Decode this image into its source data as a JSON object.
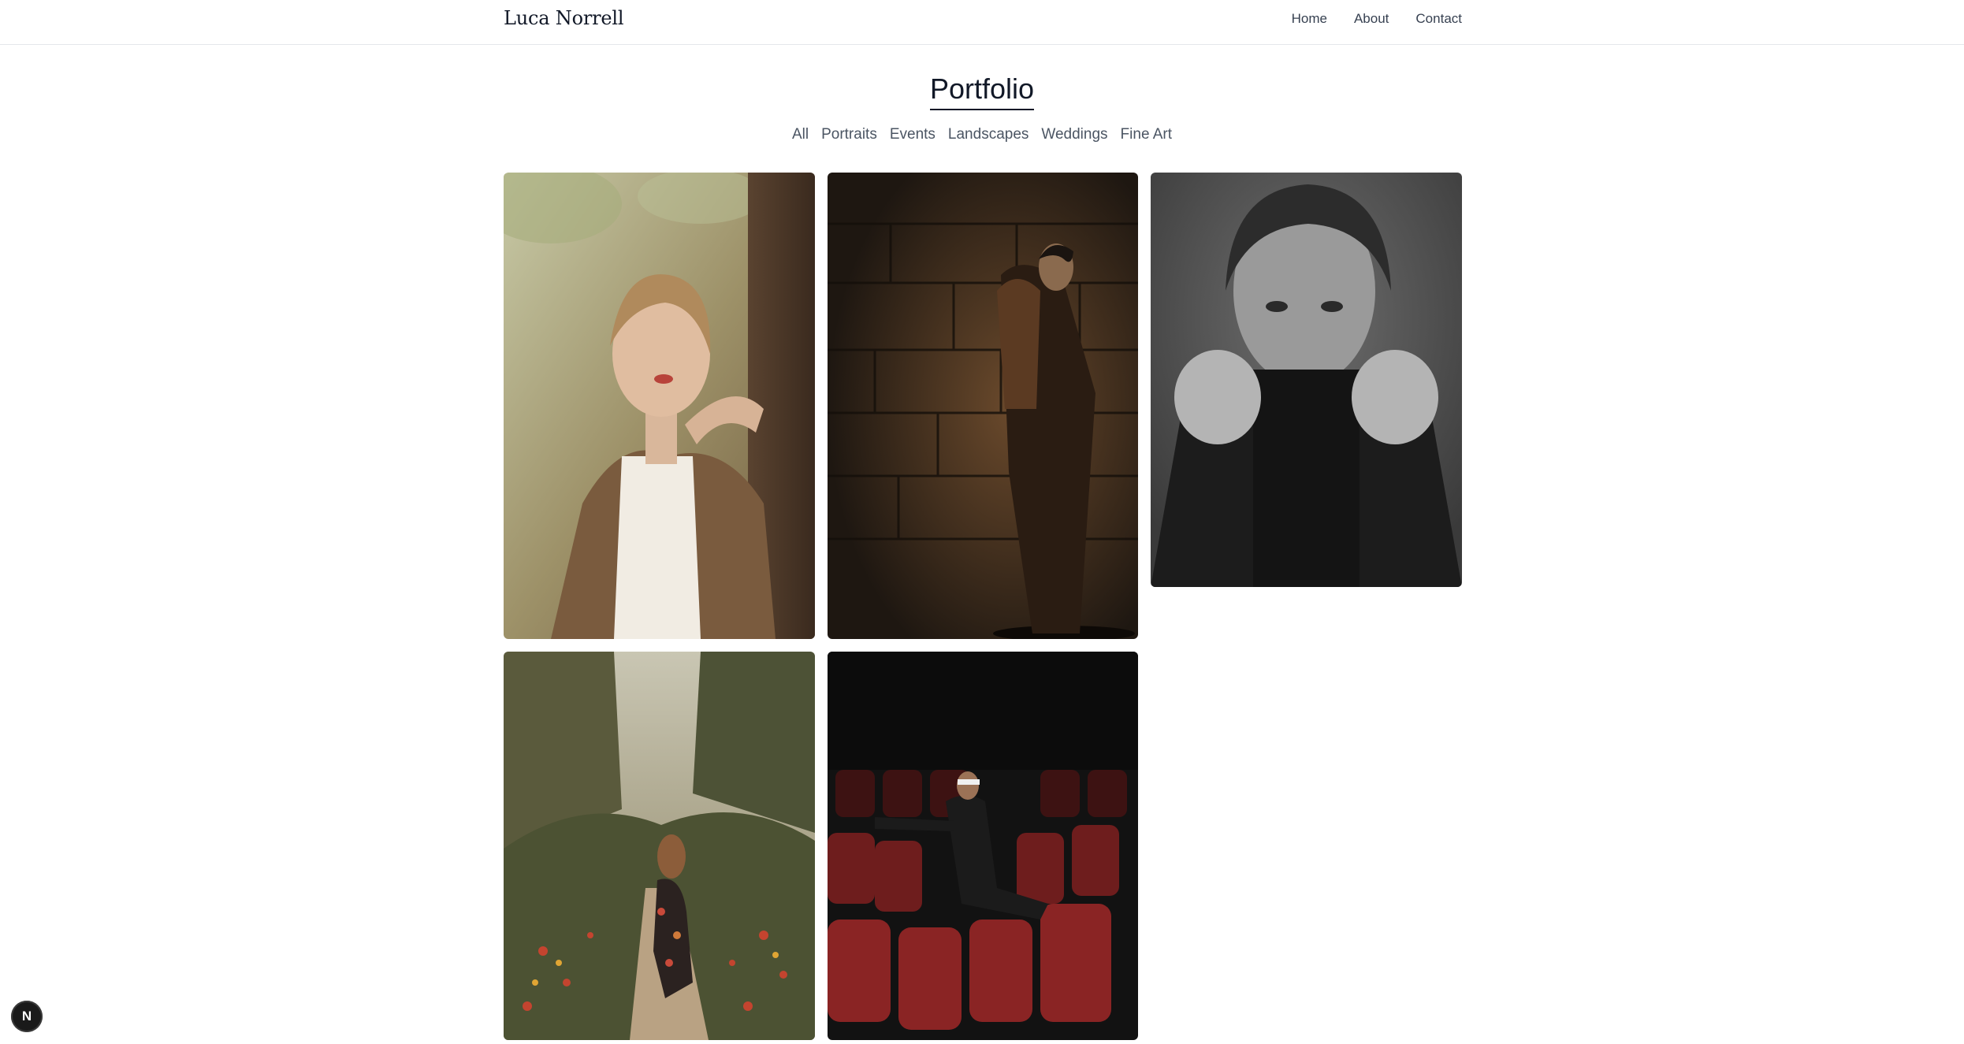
{
  "header": {
    "brand": "Luca Norrell",
    "nav": [
      {
        "label": "Home"
      },
      {
        "label": "About"
      },
      {
        "label": "Contact"
      }
    ]
  },
  "page": {
    "title": "Portfolio"
  },
  "filters": [
    {
      "label": "All"
    },
    {
      "label": "Portraits"
    },
    {
      "label": "Events"
    },
    {
      "label": "Landscapes"
    },
    {
      "label": "Weddings"
    },
    {
      "label": "Fine Art"
    }
  ],
  "photos": [
    {
      "subject": "woman leaning on tree in olive grove"
    },
    {
      "subject": "man in long coat against stone wall"
    },
    {
      "subject": "black and white portrait with sweater pulled up"
    },
    {
      "subject": "woman walking down garden path"
    },
    {
      "subject": "woman sitting in red cinema seats"
    }
  ],
  "badge": {
    "letter": "N"
  },
  "colors": {
    "text": "#1f2937",
    "divider": "#e5e7eb",
    "badge": "#1a1a1a"
  }
}
